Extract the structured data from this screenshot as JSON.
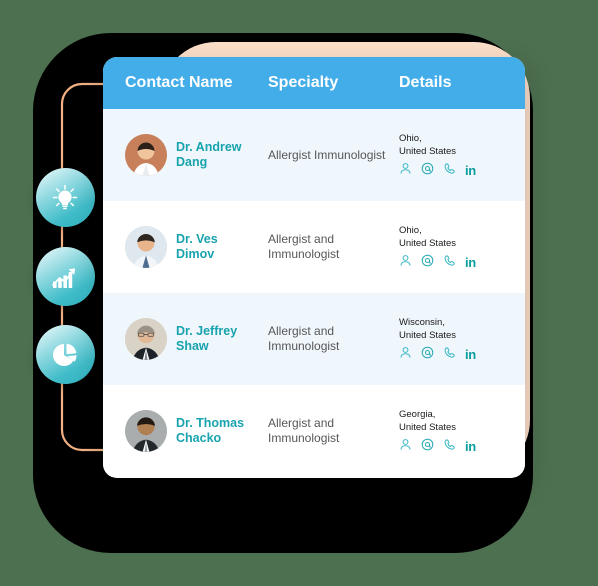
{
  "canvas": {
    "background_color": "#4d7050",
    "backing_plate_color": "#000000",
    "peach_panel_color": "#fbdfc9",
    "connector_color": "#f3b183"
  },
  "side_rail": {
    "items": [
      {
        "icon": "lightbulb-icon",
        "accent": "#3fbcc8"
      },
      {
        "icon": "bar-chart-growth-icon",
        "accent": "#3fbcc8"
      },
      {
        "icon": "pie-chart-icon",
        "accent": "#3fbcc8"
      }
    ]
  },
  "table": {
    "header_color": "#43adea",
    "link_color": "#18a3ae",
    "columns": [
      {
        "label": "Contact Name"
      },
      {
        "label": "Specialty"
      },
      {
        "label": "Details"
      }
    ],
    "rows": [
      {
        "name": "Dr. Andrew Dang",
        "specialty": "Allergist Immunologist",
        "location_line1": "Ohio,",
        "location_line2": "United States",
        "actions": [
          "person-icon",
          "email-icon",
          "phone-icon",
          "linkedin-icon"
        ],
        "linkedin_label": "in"
      },
      {
        "name": "Dr. Ves Dimov",
        "specialty": "Allergist and Immunologist",
        "location_line1": "Ohio,",
        "location_line2": "United States",
        "actions": [
          "person-icon",
          "email-icon",
          "phone-icon",
          "linkedin-icon"
        ],
        "linkedin_label": "in"
      },
      {
        "name": "Dr. Jeffrey Shaw",
        "specialty": "Allergist and Immunologist",
        "location_line1": "Wisconsin,",
        "location_line2": "United States",
        "actions": [
          "person-icon",
          "email-icon",
          "phone-icon",
          "linkedin-icon"
        ],
        "linkedin_label": "in"
      },
      {
        "name": "Dr. Thomas Chacko",
        "specialty": "Allergist and Immunologist",
        "location_line1": "Georgia,",
        "location_line2": "United States",
        "actions": [
          "person-icon",
          "email-icon",
          "phone-icon",
          "linkedin-icon"
        ],
        "linkedin_label": "in"
      }
    ]
  }
}
